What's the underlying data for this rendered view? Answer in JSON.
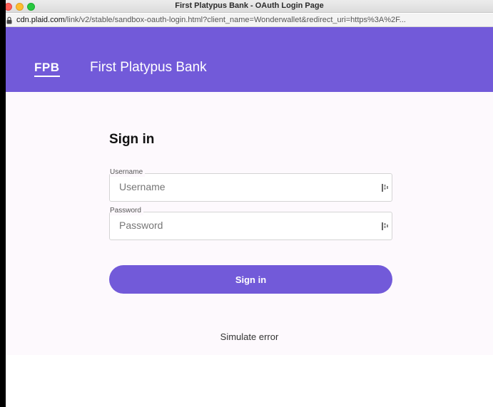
{
  "window": {
    "title": "First Platypus Bank - OAuth Login Page"
  },
  "urlbar": {
    "host": "cdn.plaid.com",
    "path": "/link/v2/stable/sandbox-oauth-login.html?client_name=Wonderwallet&redirect_uri=https%3A%2F..."
  },
  "header": {
    "logo": "FPB",
    "bank_name": "First Platypus Bank",
    "color": "#725ad9"
  },
  "form": {
    "title": "Sign in",
    "username": {
      "label": "Username",
      "placeholder": "Username",
      "value": ""
    },
    "password": {
      "label": "Password",
      "placeholder": "Password",
      "value": ""
    },
    "submit_label": "Sign in",
    "simulate_error_label": "Simulate error"
  },
  "icons": {
    "lock": "lock-icon",
    "password_manager": "keypass-icon"
  }
}
